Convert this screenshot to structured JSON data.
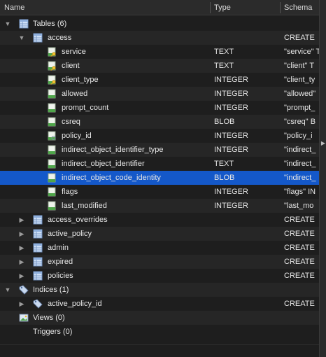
{
  "columns": {
    "name": "Name",
    "type": "Type",
    "schema": "Schema"
  },
  "tree": {
    "tables": {
      "label": "Tables (6)"
    },
    "access": {
      "label": "access",
      "schema": "CREATE"
    },
    "fields": [
      {
        "name": "service",
        "type": "TEXT",
        "schema": "\"service\" T"
      },
      {
        "name": "client",
        "type": "TEXT",
        "schema": "\"client\" T"
      },
      {
        "name": "client_type",
        "type": "INTEGER",
        "schema": "\"client_ty"
      },
      {
        "name": "allowed",
        "type": "INTEGER",
        "schema": "\"allowed\""
      },
      {
        "name": "prompt_count",
        "type": "INTEGER",
        "schema": "\"prompt_"
      },
      {
        "name": "csreq",
        "type": "BLOB",
        "schema": "\"csreq\" B"
      },
      {
        "name": "policy_id",
        "type": "INTEGER",
        "schema": "\"policy_i"
      },
      {
        "name": "indirect_object_identifier_type",
        "type": "INTEGER",
        "schema": "\"indirect_"
      },
      {
        "name": "indirect_object_identifier",
        "type": "TEXT",
        "schema": "\"indirect_"
      },
      {
        "name": "indirect_object_code_identity",
        "type": "BLOB",
        "schema": "\"indirect_"
      },
      {
        "name": "flags",
        "type": "INTEGER",
        "schema": "\"flags\" IN"
      },
      {
        "name": "last_modified",
        "type": "INTEGER",
        "schema": "\"last_mo"
      }
    ],
    "other_tables": [
      {
        "name": "access_overrides",
        "schema": "CREATE"
      },
      {
        "name": "active_policy",
        "schema": "CREATE"
      },
      {
        "name": "admin",
        "schema": "CREATE"
      },
      {
        "name": "expired",
        "schema": "CREATE"
      },
      {
        "name": "policies",
        "schema": "CREATE"
      }
    ],
    "indices": {
      "label": "Indices (1)"
    },
    "index_items": [
      {
        "name": "active_policy_id",
        "schema": "CREATE"
      }
    ],
    "views": {
      "label": "Views (0)"
    },
    "triggers": {
      "label": "Triggers (0)"
    }
  },
  "icons": {
    "table": "table-icon",
    "field_key": "key-field-icon",
    "field": "field-icon",
    "index": "tag-icon",
    "view": "image-icon"
  },
  "colors": {
    "background": "#1e1e1e",
    "selection": "#1458c9",
    "header": "#2b2b2b"
  }
}
